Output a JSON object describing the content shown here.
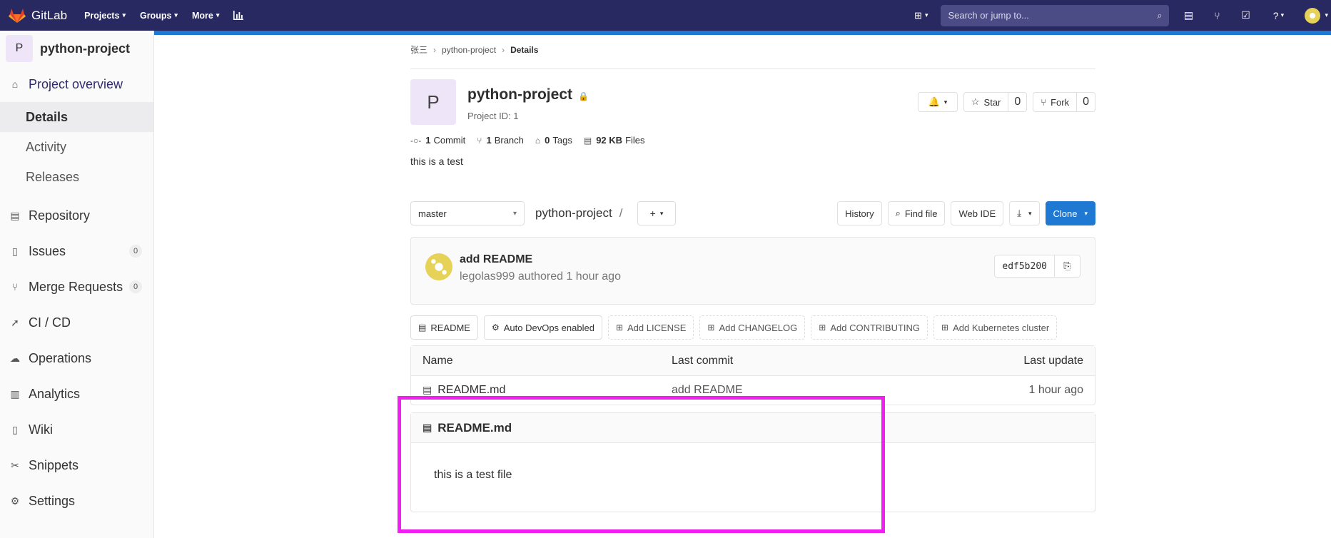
{
  "topbar": {
    "brand": "GitLab",
    "nav": [
      "Projects",
      "Groups",
      "More"
    ],
    "search_placeholder": "Search or jump to..."
  },
  "sidebar": {
    "project_initial": "P",
    "project_name": "python-project",
    "overview": "Project overview",
    "overview_sub": [
      "Details",
      "Activity",
      "Releases"
    ],
    "items": [
      {
        "label": "Repository"
      },
      {
        "label": "Issues",
        "count": "0"
      },
      {
        "label": "Merge Requests",
        "count": "0"
      },
      {
        "label": "CI / CD"
      },
      {
        "label": "Operations"
      },
      {
        "label": "Analytics"
      },
      {
        "label": "Wiki"
      },
      {
        "label": "Snippets"
      },
      {
        "label": "Settings"
      }
    ]
  },
  "breadcrumb": {
    "owner": "张三",
    "project": "python-project",
    "current": "Details"
  },
  "project": {
    "initial": "P",
    "title": "python-project",
    "id_label": "Project ID: 1",
    "star_label": "Star",
    "star_count": "0",
    "fork_label": "Fork",
    "fork_count": "0",
    "stats": {
      "commits": "1",
      "commits_label": "Commit",
      "branches": "1",
      "branches_label": "Branch",
      "tags": "0",
      "tags_label": "Tags",
      "files": "92 KB",
      "files_label": "Files"
    },
    "description": "this is a test"
  },
  "toolbar": {
    "branch": "master",
    "path": "python-project",
    "history": "History",
    "find_file": "Find file",
    "web_ide": "Web IDE",
    "clone": "Clone"
  },
  "last_commit": {
    "message": "add README",
    "meta": "legolas999 authored 1 hour ago",
    "sha": "edf5b200"
  },
  "badges": [
    "README",
    "Auto DevOps enabled",
    "Add LICENSE",
    "Add CHANGELOG",
    "Add CONTRIBUTING",
    "Add Kubernetes cluster"
  ],
  "tree": {
    "headers": {
      "name": "Name",
      "commit": "Last commit",
      "update": "Last update"
    },
    "rows": [
      {
        "name": "README.md",
        "commit": "add README",
        "update": "1 hour ago"
      }
    ]
  },
  "readme": {
    "file": "README.md",
    "body": "this is a test file"
  },
  "colors": {
    "navbar": "#292961",
    "accent": "#1f78d1",
    "highlight": "#f020f0"
  }
}
